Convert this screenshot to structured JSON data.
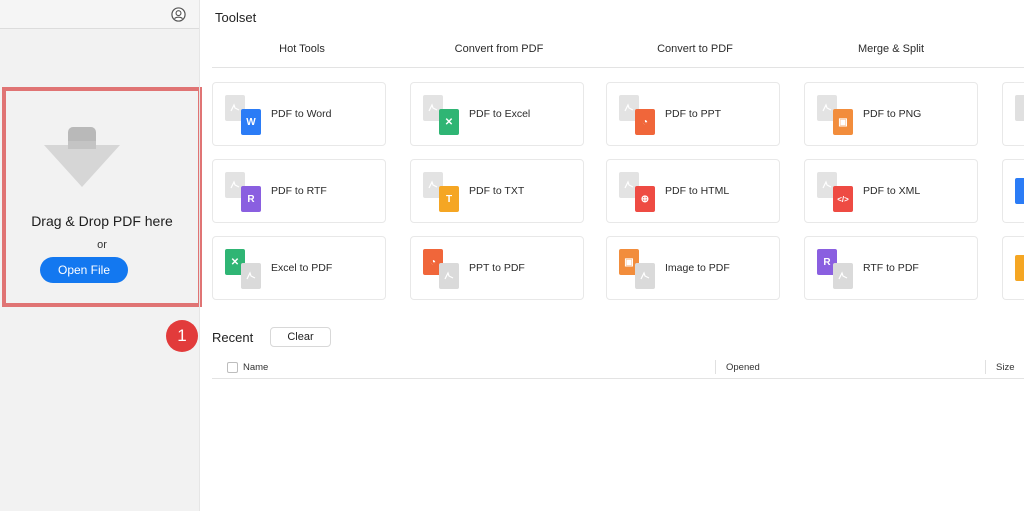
{
  "sidebar": {
    "drop_text": "Drag & Drop PDF here",
    "or_text": "or",
    "open_button": "Open File",
    "avatar_icon": "user-avatar-icon"
  },
  "main": {
    "toolset_title": "Toolset",
    "tabs": [
      {
        "label": "Hot Tools"
      },
      {
        "label": "Convert from PDF"
      },
      {
        "label": "Convert to PDF"
      },
      {
        "label": "Merge & Split"
      }
    ],
    "tools": [
      {
        "label": "PDF to Word",
        "icon": "word-icon",
        "color": "#2b7cf6"
      },
      {
        "label": "PDF to Excel",
        "icon": "excel-icon",
        "color": "#2fb574"
      },
      {
        "label": "PDF to PPT",
        "icon": "ppt-icon",
        "color": "#f0663a"
      },
      {
        "label": "PDF to PNG",
        "icon": "image-icon",
        "color": "#f28d3c"
      },
      {
        "label": "PDF to RTF",
        "icon": "rtf-icon",
        "color": "#8a5fe0"
      },
      {
        "label": "PDF to TXT",
        "icon": "txt-icon",
        "color": "#f5a623"
      },
      {
        "label": "PDF to HTML",
        "icon": "html-icon",
        "color": "#ee4b43"
      },
      {
        "label": "PDF to XML",
        "icon": "xml-icon",
        "color": "#ee4b43"
      },
      {
        "label": "Excel to PDF",
        "icon": "excel-icon",
        "color": "#2fb574"
      },
      {
        "label": "PPT to PDF",
        "icon": "ppt-icon",
        "color": "#f0663a"
      },
      {
        "label": "Image to PDF",
        "icon": "image-icon",
        "color": "#f28d3c"
      },
      {
        "label": "RTF to PDF",
        "icon": "rtf-icon",
        "color": "#8a5fe0"
      }
    ],
    "partial_column_colors": [
      "#e0e0e0",
      "#2b7cf6",
      "#f5a623"
    ]
  },
  "recent": {
    "step_number": "1",
    "title": "Recent",
    "clear_button": "Clear",
    "columns": {
      "name": "Name",
      "opened": "Opened",
      "size": "Size"
    }
  },
  "colors": {
    "accent": "#1378f0",
    "highlight_border": "#e07474",
    "step_badge": "#e23b3b"
  }
}
